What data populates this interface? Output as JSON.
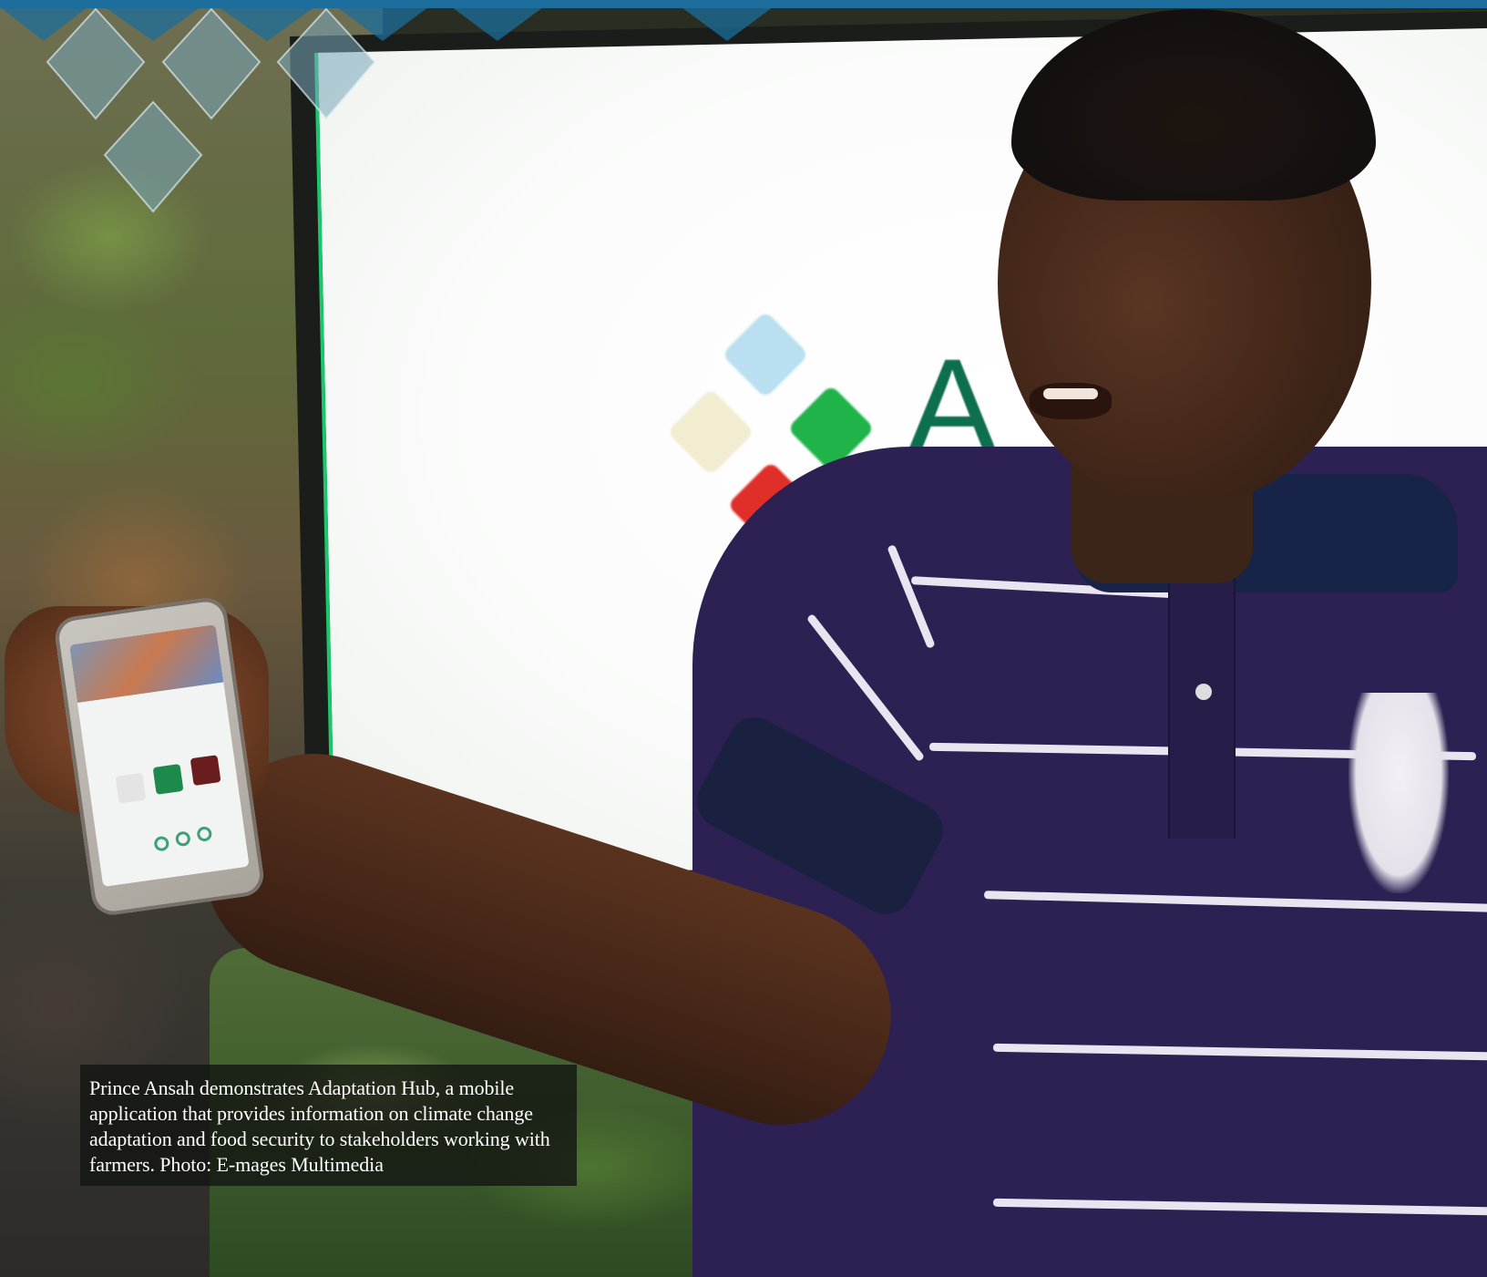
{
  "caption": {
    "text": "Prince Ansah demonstrates Adaptation Hub, a mobile application that provides information on climate change adaptation and food security to stakeholders working with farmers. Photo: E-mages Multimedia"
  },
  "screen_logo": {
    "visible_text": "A"
  },
  "colors": {
    "brand_strip": "#1c6d9c",
    "logo_blue": "#b9dff0",
    "logo_cream": "#f2ecd0",
    "logo_green": "#1fb34a",
    "logo_red": "#e02f28",
    "shirt": "#2c2152",
    "caption_bg": "#141612"
  },
  "decor": {
    "lattice_icon": "diamond-lattice-icon"
  }
}
